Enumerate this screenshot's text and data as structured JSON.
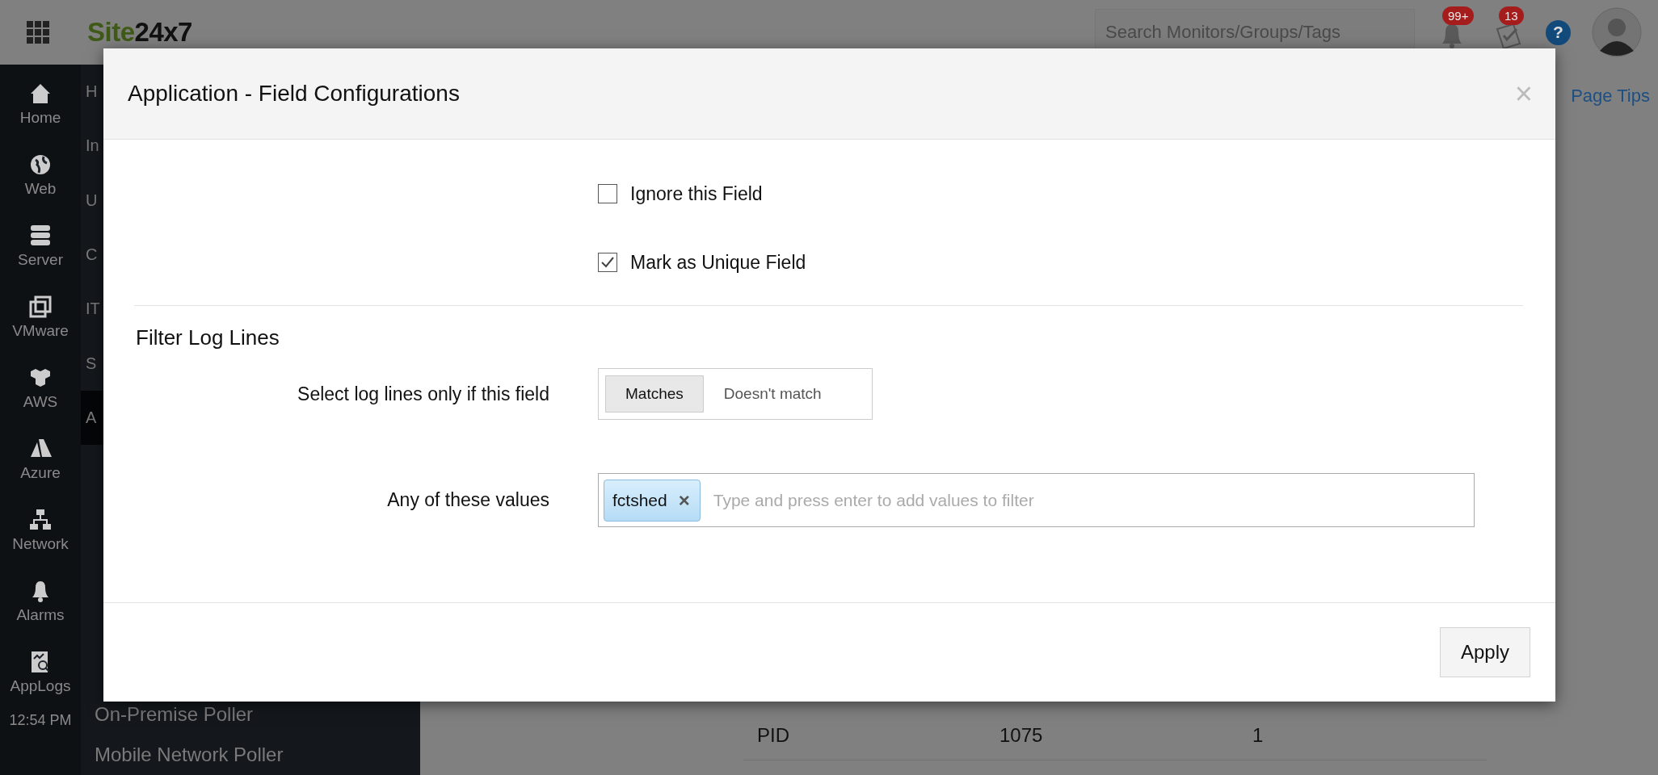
{
  "topbar": {
    "logo": {
      "accent": "Site",
      "rest": "24x7"
    },
    "search": {
      "placeholder": "Search Monitors/Groups/Tags"
    },
    "badges": [
      {
        "kind": "alerts",
        "count": "99+"
      },
      {
        "kind": "tasks",
        "count": "13"
      }
    ],
    "help": "?"
  },
  "nav_rail": {
    "items": [
      {
        "kind": "home",
        "label": "Home"
      },
      {
        "kind": "web",
        "label": "Web"
      },
      {
        "kind": "server",
        "label": "Server"
      },
      {
        "kind": "vmware",
        "label": "VMware"
      },
      {
        "kind": "aws",
        "label": "AWS"
      },
      {
        "kind": "azure",
        "label": "Azure"
      },
      {
        "kind": "network",
        "label": "Network"
      },
      {
        "kind": "alarms",
        "label": "Alarms"
      },
      {
        "kind": "applogs",
        "label": "AppLogs"
      }
    ],
    "time": "12:54 PM"
  },
  "sub_nav": {
    "items": [
      {
        "label": "H",
        "selected": false
      },
      {
        "label": "In",
        "selected": false
      },
      {
        "label": "U",
        "selected": false
      },
      {
        "label": "C",
        "selected": false
      },
      {
        "label": "IT",
        "selected": false
      },
      {
        "label": "S",
        "selected": false
      },
      {
        "label": "A",
        "selected": true
      }
    ],
    "lower_items": [
      {
        "label": "On-Premise Poller"
      },
      {
        "label": "Mobile Network Poller"
      }
    ]
  },
  "content": {
    "page_tips": "Page Tips",
    "table_row": [
      "PID",
      "1075",
      "1"
    ]
  },
  "dialog": {
    "title": "Application - Field Configurations",
    "close": "×",
    "checkboxes": [
      {
        "label": "Ignore this Field",
        "checked": false
      },
      {
        "label": "Mark as Unique Field",
        "checked": true
      }
    ],
    "section_title": "Filter Log Lines",
    "match_label": "Select log lines only if this field",
    "match_options": [
      {
        "label": "Matches",
        "selected": true
      },
      {
        "label": "Doesn't match",
        "selected": false
      }
    ],
    "values_label": "Any of these values",
    "values": {
      "tags": [
        {
          "label": "fctshed",
          "remove": "×"
        }
      ],
      "placeholder": "Type and press enter to add values to filter"
    },
    "apply": "Apply"
  }
}
